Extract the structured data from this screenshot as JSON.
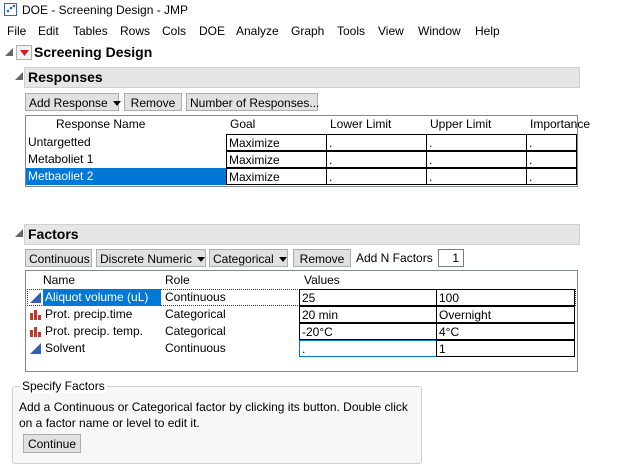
{
  "window": {
    "title": "DOE - Screening Design - JMP"
  },
  "menu": [
    "File",
    "Edit",
    "Tables",
    "Rows",
    "Cols",
    "DOE",
    "Analyze",
    "Graph",
    "Tools",
    "View",
    "Window",
    "Help"
  ],
  "outline": {
    "title": "Screening Design"
  },
  "responses": {
    "title": "Responses",
    "buttons": {
      "add": "Add Response",
      "remove": "Remove",
      "number": "Number of Responses..."
    },
    "columns": [
      "Response Name",
      "Goal",
      "Lower Limit",
      "Upper Limit",
      "Importance"
    ],
    "rows": [
      {
        "name": "Untargetted",
        "goal": "Maximize",
        "lower": ".",
        "upper": ".",
        "importance": "."
      },
      {
        "name": "Metaboliet 1",
        "goal": "Maximize",
        "lower": ".",
        "upper": ".",
        "importance": "."
      },
      {
        "name": "Metbaoliet 2",
        "goal": "Maximize",
        "lower": ".",
        "upper": ".",
        "importance": ".",
        "selected": true
      }
    ]
  },
  "factors": {
    "title": "Factors",
    "buttons": {
      "continuous": "Continuous",
      "discrete": "Discrete Numeric",
      "categorical": "Categorical",
      "remove": "Remove",
      "add_n": "Add N Factors",
      "n_value": "1"
    },
    "columns": [
      "Name",
      "Role",
      "Values"
    ],
    "rows": [
      {
        "name": "Aliquot volume (uL)",
        "role": "Continuous",
        "v1": "25",
        "v2": "100",
        "icon": "continuous-icon",
        "selected": true
      },
      {
        "name": "Prot. precip.time",
        "role": "Categorical",
        "v1": "20 min",
        "v2": "Overnight",
        "icon": "categorical-icon"
      },
      {
        "name": "Prot. precip. temp.",
        "role": "Categorical",
        "v1": "-20°C",
        "v2": "4°C",
        "icon": "categorical-icon"
      },
      {
        "name": "Solvent",
        "role": "Continuous",
        "v1": ".",
        "v2": "1",
        "icon": "continuous-icon"
      }
    ]
  },
  "specify": {
    "title": "Specify Factors",
    "text1": "Add a Continuous or Categorical factor by clicking its button. Double click",
    "text2": "on a factor name or level to edit it.",
    "button": "Continue"
  }
}
